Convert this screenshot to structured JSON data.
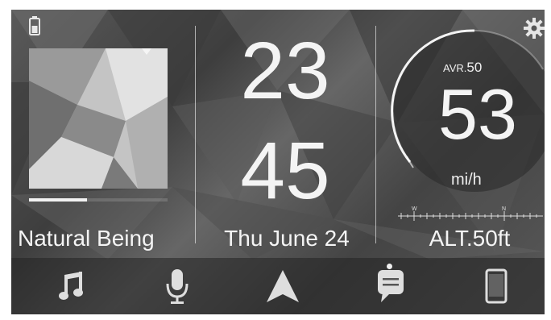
{
  "status": {
    "battery_icon": "battery-icon",
    "settings_icon": "gear-icon"
  },
  "media": {
    "song_title": "Natural Being",
    "progress": 0.42
  },
  "clock": {
    "hours": "23",
    "minutes": "45",
    "date": "Thu June 24"
  },
  "speedometer": {
    "avg_label": "AVR.",
    "avg_value": "50",
    "speed": "53",
    "unit": "mi/h",
    "compass_w": "W",
    "compass_n": "N"
  },
  "altitude": {
    "label": "ALT.50ft"
  },
  "bottom_nav": [
    {
      "icon": "music-note-icon"
    },
    {
      "icon": "microphone-icon"
    },
    {
      "icon": "navigation-arrow-icon"
    },
    {
      "icon": "message-icon"
    },
    {
      "icon": "phone-icon"
    }
  ],
  "colors": {
    "text": "#f4f4f4",
    "background": "#4a4a4a"
  }
}
